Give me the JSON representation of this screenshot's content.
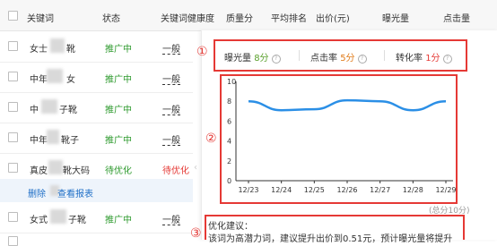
{
  "table": {
    "headers": {
      "keyword": "关键词",
      "status": "状态",
      "health": "关键词健康度",
      "quality": "质量分",
      "avg_rank": "平均排名",
      "bid": "出价(元)",
      "impressions": "曝光量",
      "clicks": "点击量"
    },
    "rows": [
      {
        "keyword_start": "女士",
        "keyword_end": "靴",
        "status": "推广中",
        "level": "一般"
      },
      {
        "keyword_start": "中年",
        "keyword_end": "女",
        "status": "推广中",
        "level": "一般"
      },
      {
        "keyword_start": "中",
        "keyword_end": "子靴",
        "status": "推广中",
        "level": "一般"
      },
      {
        "keyword_start": "中年",
        "keyword_end": "靴子",
        "status": "推广中",
        "level": "一般"
      },
      {
        "keyword_start": "真皮",
        "keyword_end": "靴大码",
        "status": "待优化",
        "level": ""
      },
      {
        "keyword_start": "女式",
        "keyword_end": "子靴",
        "status": "推广中",
        "level": "一般"
      }
    ],
    "actions": {
      "delete": "删除",
      "report": "查看报表"
    }
  },
  "popup": {
    "markers": [
      "①",
      "②",
      "③"
    ],
    "stats": [
      {
        "label": "曝光量",
        "value": "8分"
      },
      {
        "label": "点击率",
        "value": "5分"
      },
      {
        "label": "转化率",
        "value": "1分"
      }
    ],
    "total": "(总分10分)",
    "suggestion_title": "优化建议：",
    "suggestion_body": "该词为高潜力词，建议提升出价到0.51元，预计曝光量将提升"
  },
  "chart_data": {
    "type": "line",
    "x": [
      "12/23",
      "12/24",
      "12/25",
      "12/26",
      "12/27",
      "12/28",
      "12/29"
    ],
    "y_ticks": [
      "10",
      "8",
      "6",
      "4",
      "2",
      "0"
    ],
    "ylim": [
      0,
      10
    ],
    "series": [
      {
        "values": [
          8.0,
          7.1,
          7.2,
          8.1,
          8.0,
          7.1,
          8.0
        ]
      }
    ],
    "line_color": "#2b8fe6"
  }
}
